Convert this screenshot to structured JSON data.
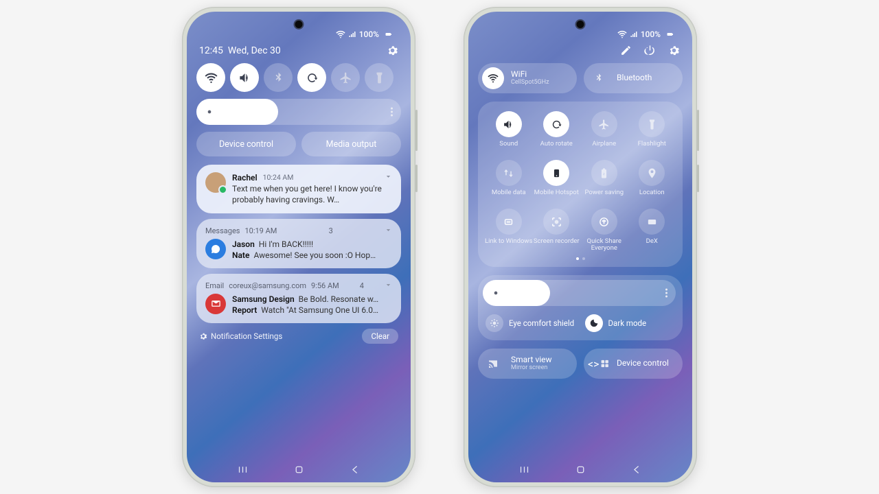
{
  "status": {
    "battery": "100%"
  },
  "phone1": {
    "time": "12:45",
    "date": "Wed, Dec 30",
    "device_control": "Device control",
    "media_output": "Media output",
    "notif1": {
      "sender": "Rachel",
      "time": "10:24 AM",
      "body": "Text me when you get here! I know you're probably having cravings. W…"
    },
    "notif2": {
      "app": "Messages",
      "time": "10:19 AM",
      "count": "3",
      "l1s": "Jason",
      "l1": "Hi I'm BACK!!!!!",
      "l2s": "Nate",
      "l2": "Awesome! See you soon :O Hop…"
    },
    "notif3": {
      "app": "Email",
      "addr": "coreux@samsung.com",
      "time": "9:56 AM",
      "count": "4",
      "l1s": "Samsung Design",
      "l1": "Be Bold. Resonate w…",
      "l2s": "Report",
      "l2": "Watch \"At Samsung One UI 6.0…"
    },
    "settings_link": "Notification Settings",
    "clear": "Clear"
  },
  "phone2": {
    "wifi": {
      "title": "WiFi",
      "sub": "CellSpot5GHz"
    },
    "bt": {
      "title": "Bluetooth"
    },
    "tiles": [
      {
        "label": "Sound",
        "on": true,
        "icon": "volume"
      },
      {
        "label": "Auto rotate",
        "on": true,
        "icon": "rotate"
      },
      {
        "label": "Airplane",
        "on": false,
        "icon": "plane"
      },
      {
        "label": "Flashlight",
        "on": false,
        "icon": "torch"
      },
      {
        "label": "Mobile data",
        "on": false,
        "icon": "data"
      },
      {
        "label": "Mobile Hotspot",
        "on": true,
        "icon": "hotspot"
      },
      {
        "label": "Power saving",
        "on": false,
        "icon": "power"
      },
      {
        "label": "Location",
        "on": false,
        "icon": "location"
      },
      {
        "label": "Link to Windows",
        "on": false,
        "icon": "link"
      },
      {
        "label": "Screen recorder",
        "on": false,
        "icon": "record"
      },
      {
        "label": "Quick Share Everyone",
        "on": false,
        "icon": "share"
      },
      {
        "label": "DeX",
        "on": false,
        "icon": "dex"
      }
    ],
    "eye": "Eye comfort shield",
    "dark": "Dark mode",
    "smart": {
      "title": "Smart view",
      "sub": "Mirror screen"
    },
    "devctrl": "Device control"
  }
}
